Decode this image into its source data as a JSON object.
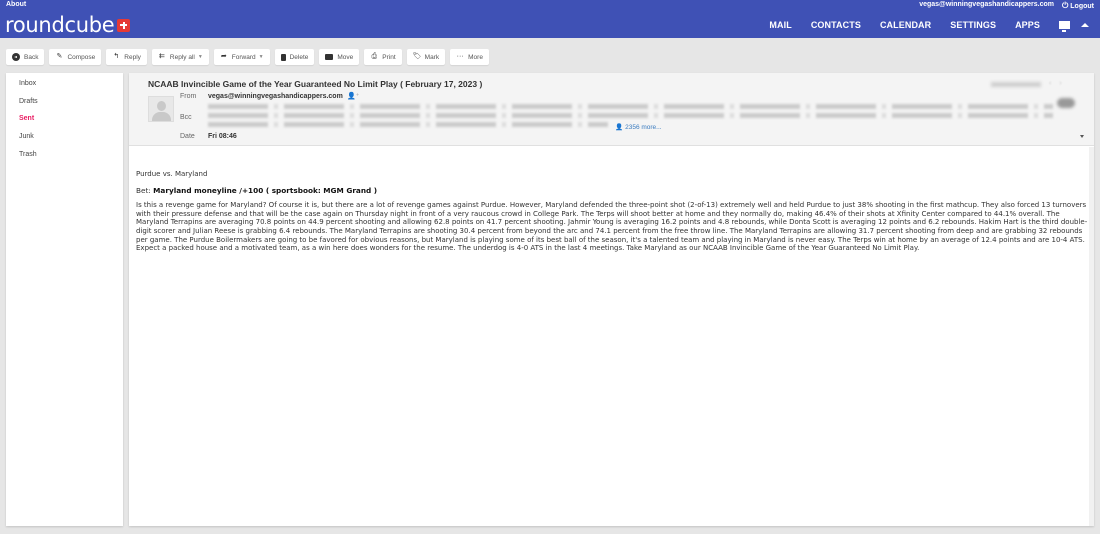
{
  "app": {
    "about_label": "About",
    "logo_text": "roundcube",
    "user_email": "vegas@winningvegashandicappers.com",
    "logout_label": "Logout",
    "brand_color": "#3f51b5",
    "accent_color": "#e91e63"
  },
  "nav": {
    "items": [
      {
        "label": "MAIL"
      },
      {
        "label": "CONTACTS"
      },
      {
        "label": "CALENDAR"
      },
      {
        "label": "SETTINGS"
      },
      {
        "label": "APPS"
      }
    ]
  },
  "toolbar": {
    "back": "Back",
    "compose": "Compose",
    "reply": "Reply",
    "reply_all": "Reply all",
    "forward": "Forward",
    "delete": "Delete",
    "move": "Move",
    "print": "Print",
    "mark": "Mark",
    "more": "More"
  },
  "folders": [
    {
      "label": "Inbox",
      "active": false
    },
    {
      "label": "Drafts",
      "active": false
    },
    {
      "label": "Sent",
      "active": true
    },
    {
      "label": "Junk",
      "active": false
    },
    {
      "label": "Trash",
      "active": false
    }
  ],
  "message": {
    "subject": "NCAAB Invincible Game of the Year Guaranteed No Limit Play ( February 17, 2023 )",
    "from_label": "From",
    "from_value": "vegas@winningvegashandicappers.com",
    "bcc_label": "Bcc",
    "bcc_more": "2356 more...",
    "date_label": "Date",
    "date_value": "Fri 08:46",
    "body": {
      "greeting": "Purdue vs. Maryland",
      "bet_label": "Bet:",
      "bet_value": "Maryland moneyline /+100 ( sportsbook: MGM Grand )",
      "paragraph": "Is this a revenge game for Maryland? Of course it is, but there are a lot of revenge games against Purdue. However, Maryland defended the three-point shot (2-of-13) extremely well and held Purdue to just 38% shooting in the first mathcup. They also forced 13 turnovers with their pressure defense and that will be the case again on Thursday night in front of a very raucous crowd in College Park. The Terps will shoot better at home and they normally do, making 46.4% of their shots at Xfinity Center compared to 44.1% overall. The Maryland Terrapins are averaging 70.8 points on 44.9 percent shooting and allowing 62.8 points on 41.7 percent shooting. Jahmir Young is averaging 16.2 points and 4.8 rebounds, while Donta Scott is averaging 12 points and 6.2 rebounds. Hakim Hart is the third double-digit scorer and Julian Reese is grabbing 6.4 rebounds. The Maryland Terrapins are shooting 30.4 percent from beyond the arc and 74.1 percent from the free throw line. The Maryland Terrapins are allowing 31.7 percent shooting from deep and are grabbing 32 rebounds per game. The Purdue Boilermakers are going to be favored for obvious reasons, but Maryland is playing some of its best ball of the season, it's a talented team and playing in Maryland is never easy. The Terps win at home by an average of 12.4 points and are 10-4 ATS. Expect a packed house and a motivated team, as a win here does wonders for the resume. The underdog is 4-0 ATS in the last 4 meetings. Take Maryland as our NCAAB Invincible Game of the Year Guaranteed No Limit Play."
    }
  }
}
